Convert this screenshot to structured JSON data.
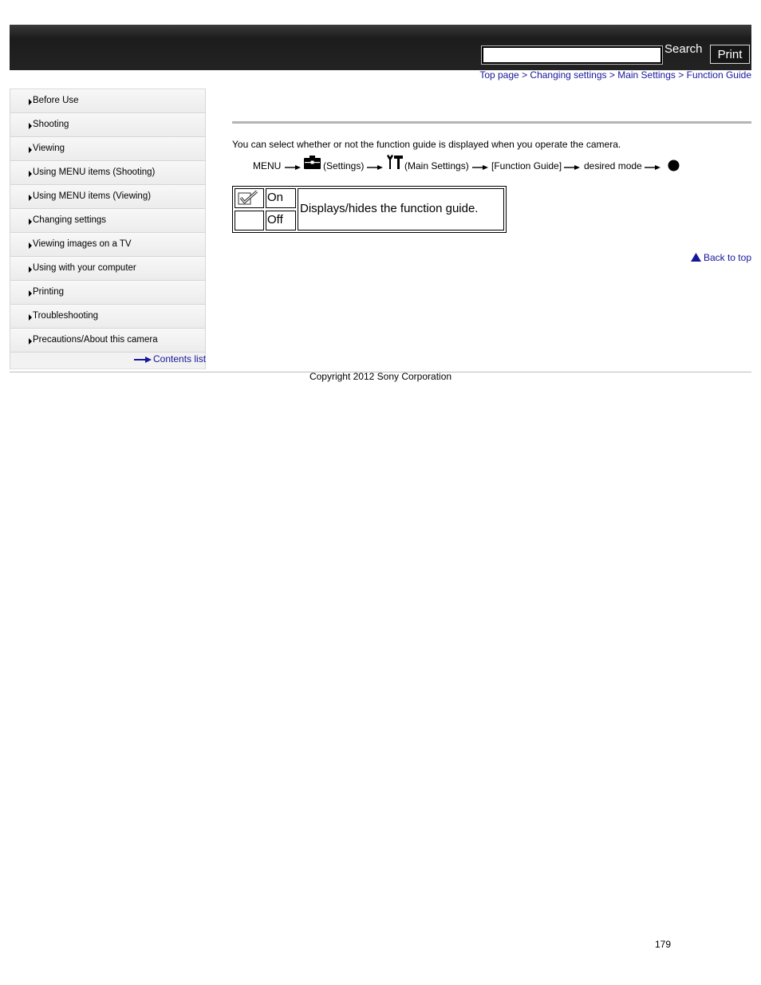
{
  "header": {
    "search_label": "Search",
    "search_value": "",
    "print_label": "Print"
  },
  "breadcrumb": {
    "items": [
      "Top page",
      "Changing settings",
      "Main Settings",
      "Function Guide"
    ],
    "separator": ">"
  },
  "sidebar": {
    "items": [
      "Before Use",
      "Shooting",
      "Viewing",
      "Using MENU items (Shooting)",
      "Using MENU items (Viewing)",
      "Changing settings",
      "Viewing images on a TV",
      "Using with your computer",
      "Printing",
      "Troubleshooting",
      "Precautions/About this camera"
    ],
    "contents_list": "Contents list"
  },
  "main": {
    "intro": "You can select whether or not the function guide is displayed when you operate the camera.",
    "menu_path": {
      "menu": "MENU",
      "settings": "(Settings)",
      "main_settings": "(Main Settings)",
      "function_guide": "[Function Guide]",
      "desired_mode": "desired mode"
    },
    "options": {
      "on": "On",
      "off": "Off",
      "description": "Displays/hides the function guide."
    },
    "back_to_top": "Back to top"
  },
  "footer": {
    "copyright": "Copyright 2012 Sony Corporation",
    "page_number": "179"
  },
  "colors": {
    "link": "#16169c",
    "header_bg": "#1c1c1c"
  }
}
